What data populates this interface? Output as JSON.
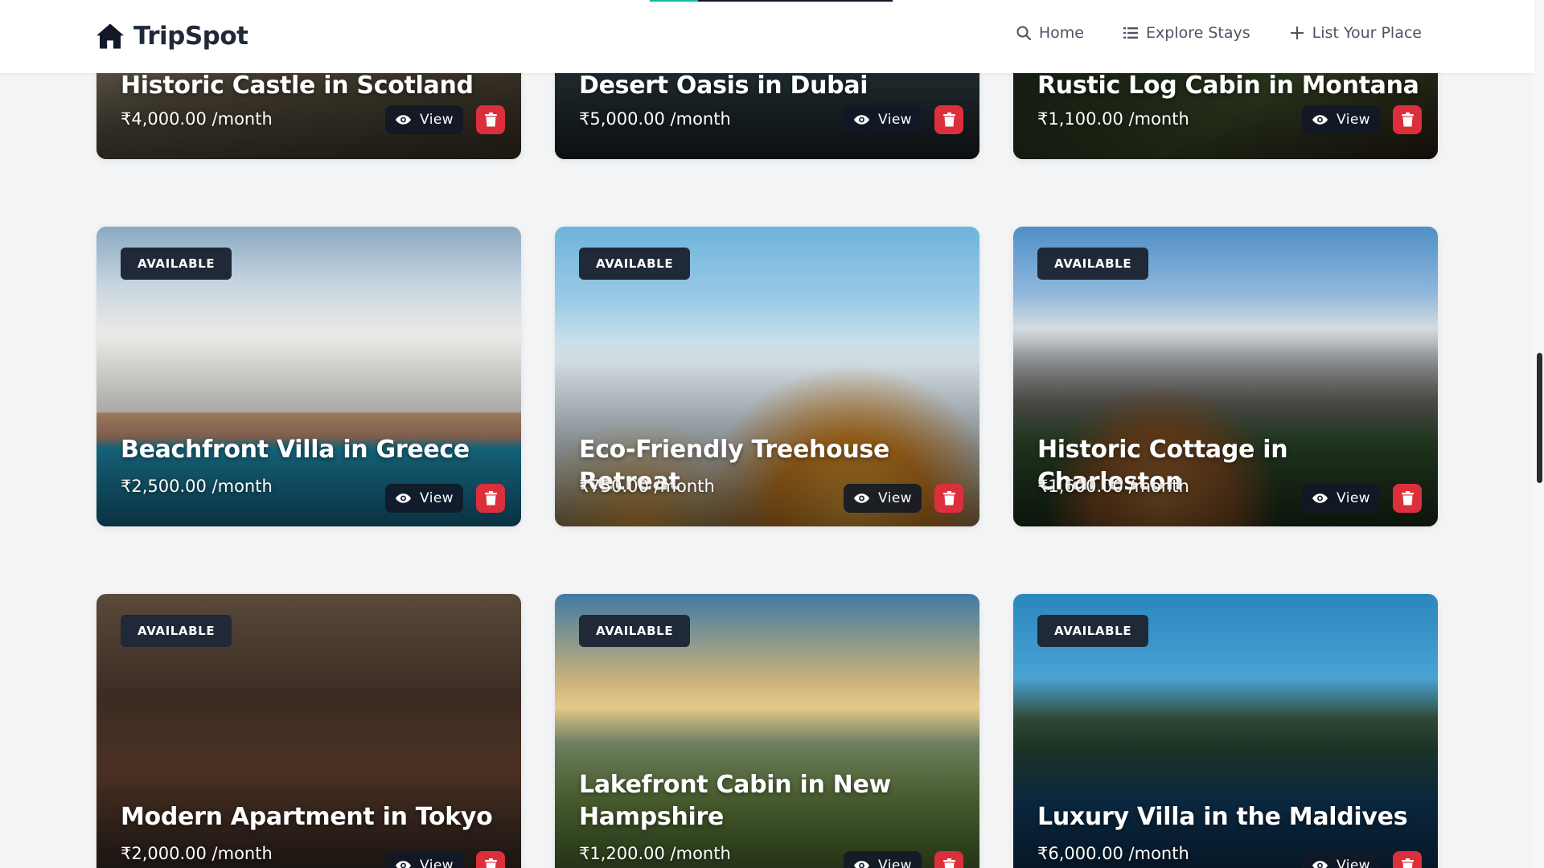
{
  "brand": {
    "name": "TripSpot",
    "logo_icon": "home-icon"
  },
  "nav": {
    "items": [
      {
        "label": "Home",
        "icon": "search-icon"
      },
      {
        "label": "Explore Stays",
        "icon": "list-icon"
      },
      {
        "label": "List Your Place",
        "icon": "plus-icon"
      }
    ]
  },
  "listings": [
    {
      "title": "Historic Castle in Scotland",
      "price": "₹4,000.00 /month",
      "badge": "",
      "view_label": "View"
    },
    {
      "title": "Desert Oasis in Dubai",
      "price": "₹5,000.00 /month",
      "badge": "",
      "view_label": "View"
    },
    {
      "title": "Rustic Log Cabin in Montana",
      "price": "₹1,100.00 /month",
      "badge": "",
      "view_label": "View"
    },
    {
      "title": "Beachfront Villa in Greece",
      "price": "₹2,500.00 /month",
      "badge": "AVAILABLE",
      "view_label": "View"
    },
    {
      "title": "Eco-Friendly Treehouse Retreat",
      "price": "₹750.00 /month",
      "badge": "AVAILABLE",
      "view_label": "View"
    },
    {
      "title": "Historic Cottage in Charleston",
      "price": "₹1,600.00 /month",
      "badge": "AVAILABLE",
      "view_label": "View"
    },
    {
      "title": "Modern Apartment in Tokyo",
      "price": "₹2,000.00 /month",
      "badge": "AVAILABLE",
      "view_label": "View"
    },
    {
      "title": "Lakefront Cabin in New Hampshire",
      "price": "₹1,200.00 /month",
      "badge": "AVAILABLE",
      "view_label": "View"
    },
    {
      "title": "Luxury Villa in the Maldives",
      "price": "₹6,000.00 /month",
      "badge": "AVAILABLE",
      "view_label": "View"
    }
  ],
  "colors": {
    "badge_bg": "#1f2937",
    "delete_button": "#dc2f3c",
    "view_button_bg": "#111827",
    "nav_text": "#4b5563",
    "page_bg": "#f3f4f6"
  }
}
